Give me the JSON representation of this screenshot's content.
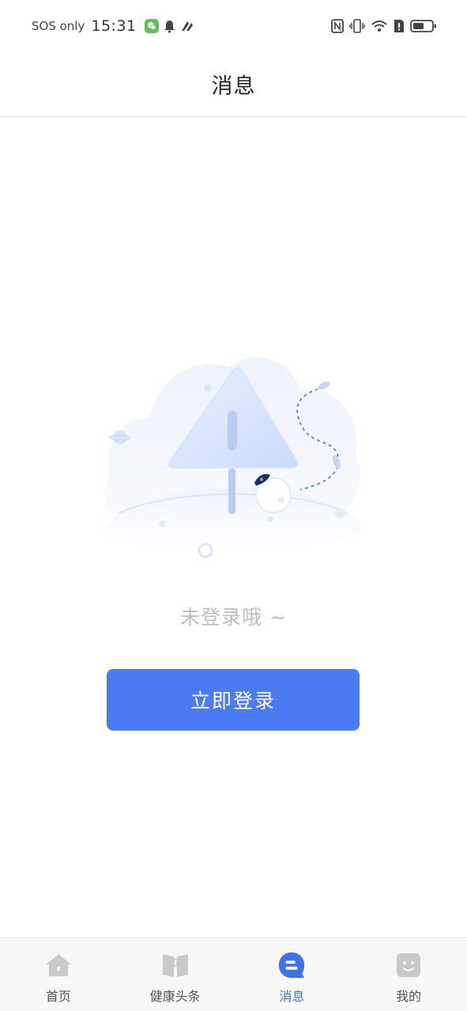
{
  "status_bar": {
    "carrier": "SOS only",
    "time": "15:31"
  },
  "header": {
    "title": "消息"
  },
  "empty_state": {
    "message": "未登录哦 ~",
    "login_button_label": "立即登录"
  },
  "bottom_nav": {
    "items": [
      {
        "label": "首页",
        "icon": "home-icon",
        "active": false
      },
      {
        "label": "健康头条",
        "icon": "book-icon",
        "active": false
      },
      {
        "label": "消息",
        "icon": "message-icon",
        "active": true
      },
      {
        "label": "我的",
        "icon": "smiley-icon",
        "active": false
      }
    ]
  },
  "colors": {
    "accent": "#4a7bf4",
    "active_nav": "#3f73e8",
    "inactive_icon": "#c9c9c9"
  }
}
